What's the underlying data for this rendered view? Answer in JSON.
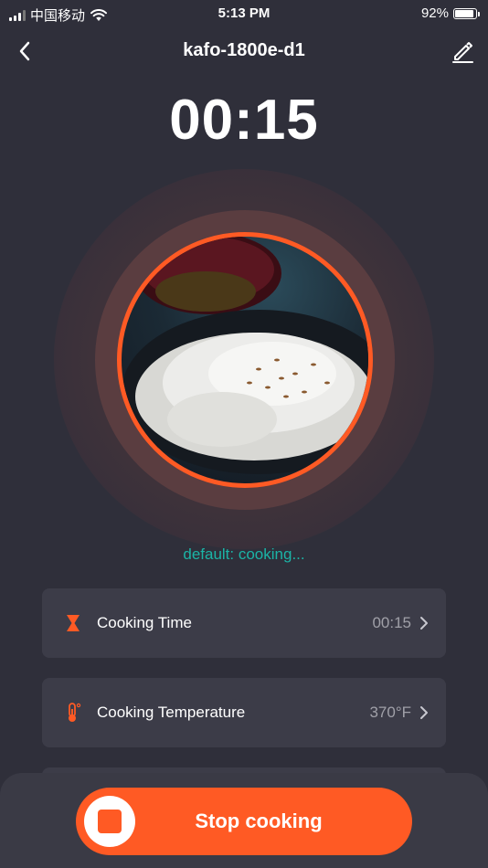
{
  "status_bar": {
    "carrier": "中国移动",
    "time": "5:13 PM",
    "battery": "92%",
    "battery_level": 0.92
  },
  "header": {
    "title": "kafo-1800e-d1",
    "back_icon": "chevron-left-icon",
    "edit_icon": "pencil-icon"
  },
  "timer": "00:15",
  "program_status": "default: cooking...",
  "settings": [
    {
      "label": "Cooking Time",
      "value": "00:15",
      "icon": "hourglass-icon"
    },
    {
      "label": "Cooking Temperature",
      "value": "370°F",
      "icon": "thermometer-icon"
    }
  ],
  "footer": {
    "stop_label": "Stop cooking"
  },
  "colors": {
    "accent": "#ff5a24",
    "status_text": "#1bb4a6",
    "background": "#2f2f3a",
    "card": "#3c3c48"
  }
}
